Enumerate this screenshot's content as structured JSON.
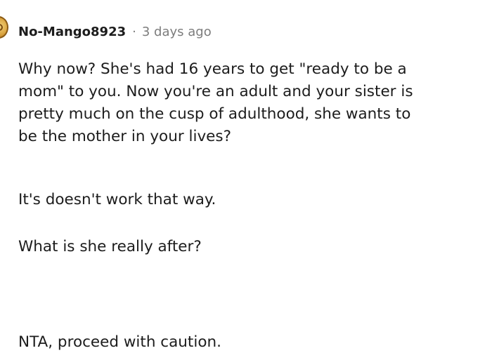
{
  "comment": {
    "avatar_icon": "user-avatar-icon",
    "username": "No-Mango8923",
    "separator": "·",
    "timestamp": "3 days ago",
    "paragraphs": [
      {
        "lines": [
          "Why now? She's had 16 years to get \"ready to be a",
          "mom\" to you. Now you're an adult and your sister is",
          "pretty much on the cusp of adulthood, she wants to",
          "be the mother in your lives?"
        ]
      },
      {
        "lines": [
          "It's doesn't work that way."
        ]
      },
      {
        "lines": [
          "What is she really after?"
        ]
      },
      {
        "lines": [
          "NTA, proceed with caution."
        ]
      }
    ]
  }
}
